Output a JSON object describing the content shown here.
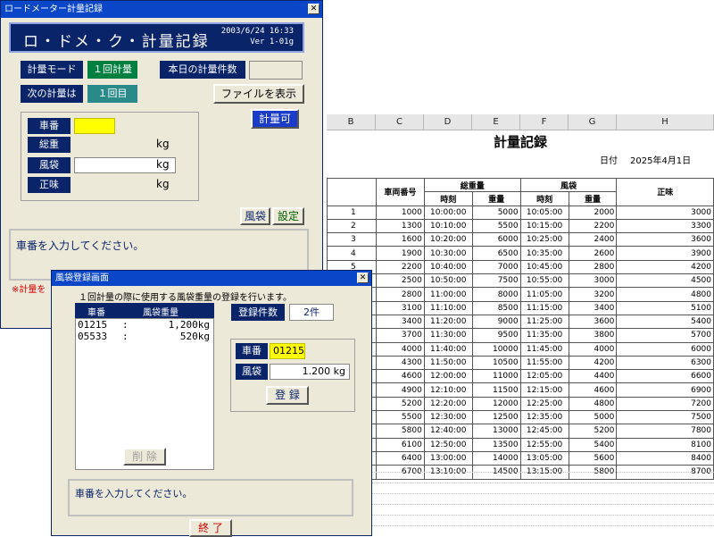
{
  "main_window": {
    "title": "ロードメーター計量記録",
    "banner_title": "ロ・ドメ・ク・計量記録",
    "banner_date": "2003/6/24 16:33",
    "banner_version": "Ver 1-01g",
    "mode_label": "計量モード",
    "mode_value": "１回計量",
    "today_count_label": "本日の計量件数",
    "today_count_value": "",
    "next_label": "次の計量は",
    "next_value": "１回目",
    "show_file_button": "ファイルを表示",
    "weigh_ok_button": "計量可",
    "fields": [
      {
        "label": "車番",
        "value": "",
        "unit": ""
      },
      {
        "label": "総重",
        "value": "",
        "unit": "kg"
      },
      {
        "label": "風袋",
        "value": "",
        "unit": "kg"
      },
      {
        "label": "正味",
        "value": "",
        "unit": "kg"
      }
    ],
    "tare_button": "風袋",
    "settings_button": "設定",
    "message": "車番を入力してください。",
    "note": "※計量を"
  },
  "sub_window": {
    "title": "風袋登録画面",
    "instruction": "１回計量の際に使用する風袋重量の登録を行います。",
    "list_header": {
      "col1": "車番",
      "col2": "風袋重量"
    },
    "list_rows": [
      {
        "car": "01215",
        "sep": ":",
        "weight": "1,200kg"
      },
      {
        "car": "05533",
        "sep": ":",
        "weight": "520kg"
      }
    ],
    "reg_count_label": "登録件数",
    "reg_count_value": "2件",
    "car_label": "車番",
    "car_value": "01215",
    "tare_label": "風袋",
    "tare_value": "1.200",
    "tare_unit": "kg",
    "register_button": "登 録",
    "delete_button": "削 除",
    "message": "車番を入力してください。",
    "end_button": "終 了"
  },
  "spreadsheet": {
    "columns": [
      "B",
      "C",
      "D",
      "E",
      "F",
      "G",
      "H"
    ],
    "title": "計量記録",
    "date_label": "日付",
    "date_value": "2025年4月1日",
    "header": {
      "car_number": "車両番号",
      "gross": "総重量",
      "tare": "風袋",
      "net": "正味",
      "time": "時刻",
      "weight": "重量"
    },
    "rows": [
      [
        "1",
        "1000",
        "10:00:00",
        "5000",
        "10:05:00",
        "2000",
        "3000"
      ],
      [
        "2",
        "1300",
        "10:10:00",
        "5500",
        "10:15:00",
        "2200",
        "3300"
      ],
      [
        "3",
        "1600",
        "10:20:00",
        "6000",
        "10:25:00",
        "2400",
        "3600"
      ],
      [
        "4",
        "1900",
        "10:30:00",
        "6500",
        "10:35:00",
        "2600",
        "3900"
      ],
      [
        "5",
        "2200",
        "10:40:00",
        "7000",
        "10:45:00",
        "2800",
        "4200"
      ],
      [
        "",
        "2500",
        "10:50:00",
        "7500",
        "10:55:00",
        "3000",
        "4500"
      ],
      [
        "",
        "2800",
        "11:00:00",
        "8000",
        "11:05:00",
        "3200",
        "4800"
      ],
      [
        "",
        "3100",
        "11:10:00",
        "8500",
        "11:15:00",
        "3400",
        "5100"
      ],
      [
        "",
        "3400",
        "11:20:00",
        "9000",
        "11:25:00",
        "3600",
        "5400"
      ],
      [
        "",
        "3700",
        "11:30:00",
        "9500",
        "11:35:00",
        "3800",
        "5700"
      ],
      [
        "",
        "4000",
        "11:40:00",
        "10000",
        "11:45:00",
        "4000",
        "6000"
      ],
      [
        "",
        "4300",
        "11:50:00",
        "10500",
        "11:55:00",
        "4200",
        "6300"
      ],
      [
        "",
        "4600",
        "12:00:00",
        "11000",
        "12:05:00",
        "4400",
        "6600"
      ],
      [
        "",
        "4900",
        "12:10:00",
        "11500",
        "12:15:00",
        "4600",
        "6900"
      ],
      [
        "",
        "5200",
        "12:20:00",
        "12000",
        "12:25:00",
        "4800",
        "7200"
      ],
      [
        "",
        "5500",
        "12:30:00",
        "12500",
        "12:35:00",
        "5000",
        "7500"
      ],
      [
        "",
        "5800",
        "12:40:00",
        "13000",
        "12:45:00",
        "5200",
        "7800"
      ],
      [
        "",
        "6100",
        "12:50:00",
        "13500",
        "12:55:00",
        "5400",
        "8100"
      ],
      [
        "",
        "6400",
        "13:00:00",
        "14000",
        "13:05:00",
        "5600",
        "8400"
      ],
      [
        "",
        "6700",
        "13:10:00",
        "14500",
        "13:15:00",
        "5800",
        "8700"
      ]
    ]
  }
}
